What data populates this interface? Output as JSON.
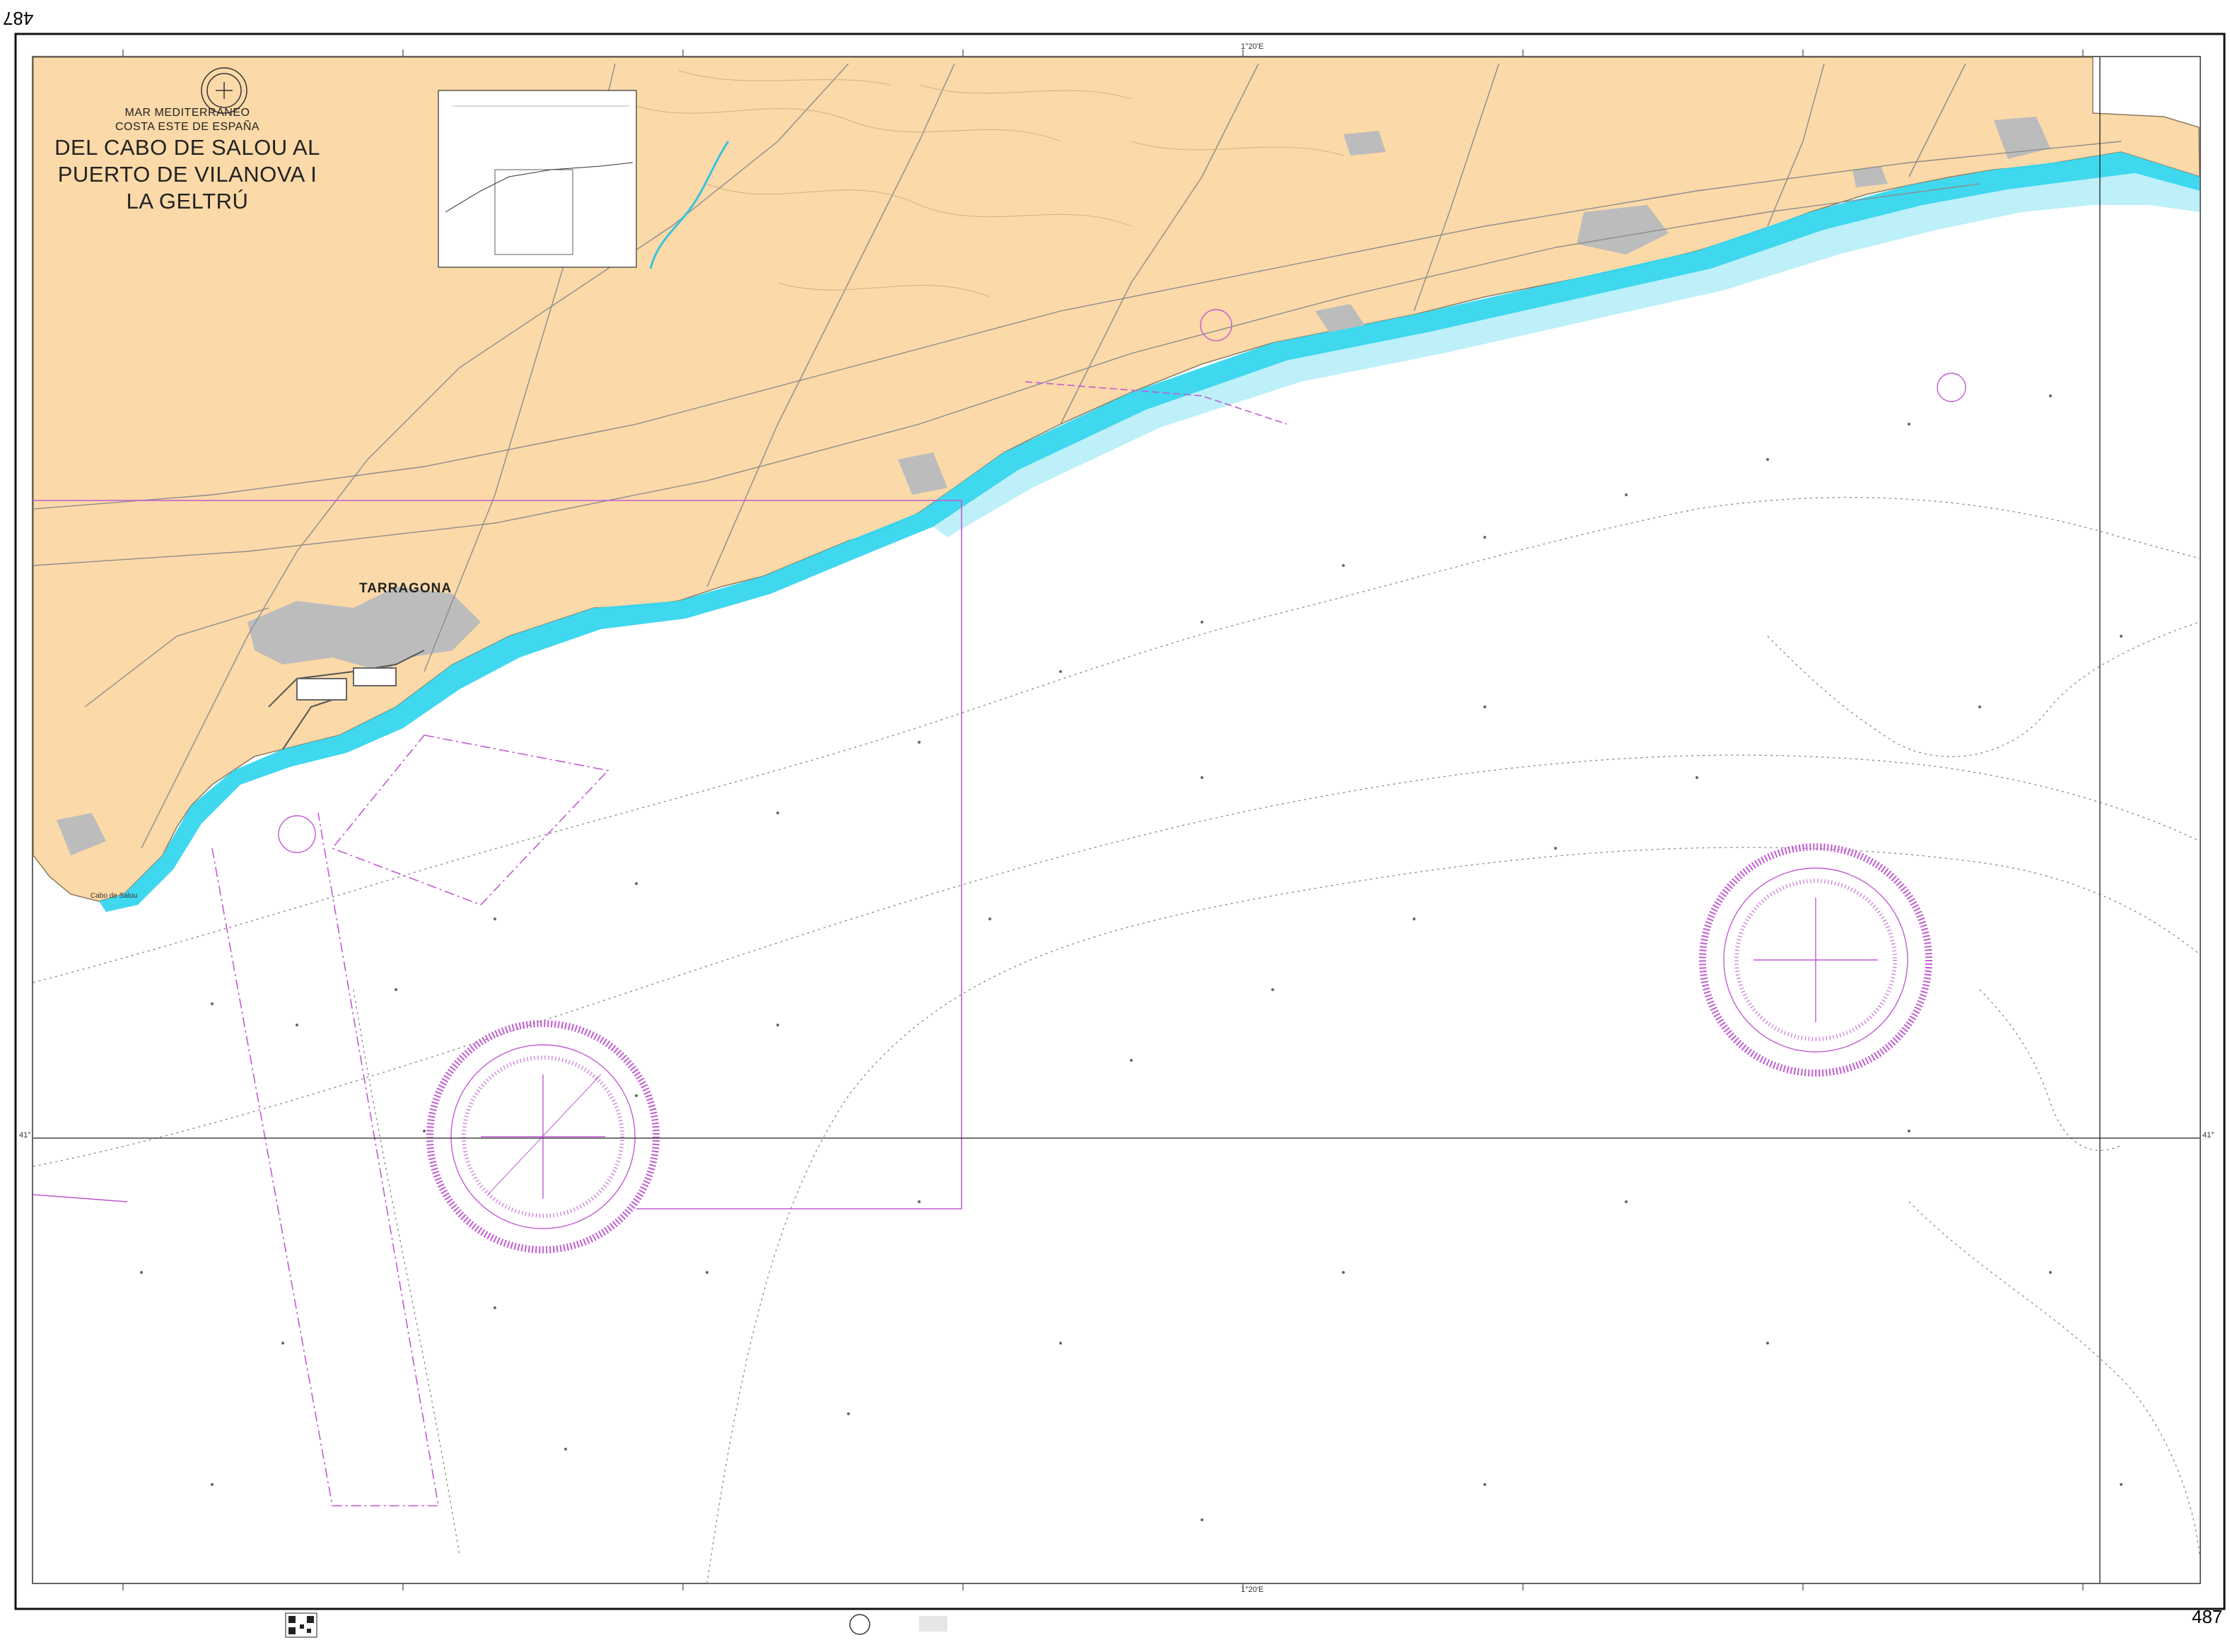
{
  "chart_number": "487",
  "title": {
    "sea": "MAR MEDITERRÁNEO",
    "region": "COSTA ESTE DE ESPAÑA",
    "line1": "DEL CABO DE SALOU AL",
    "line2": "PUERTO DE VILANOVA I LA GELTRÚ"
  },
  "places": {
    "city": "TARRAGONA",
    "cape": "Cabo de Salou"
  },
  "graticule": {
    "top_center_label": "1°20'E",
    "bottom_center_label": "1°20'E",
    "lat_mark": "41°"
  },
  "colors": {
    "land": "#fbd9a8",
    "shallow_water": "#35d6ee",
    "mid_water": "#bdf0f8",
    "urban": "#bcbcbc",
    "magenta": "#c25bd3",
    "ink": "#333333"
  }
}
